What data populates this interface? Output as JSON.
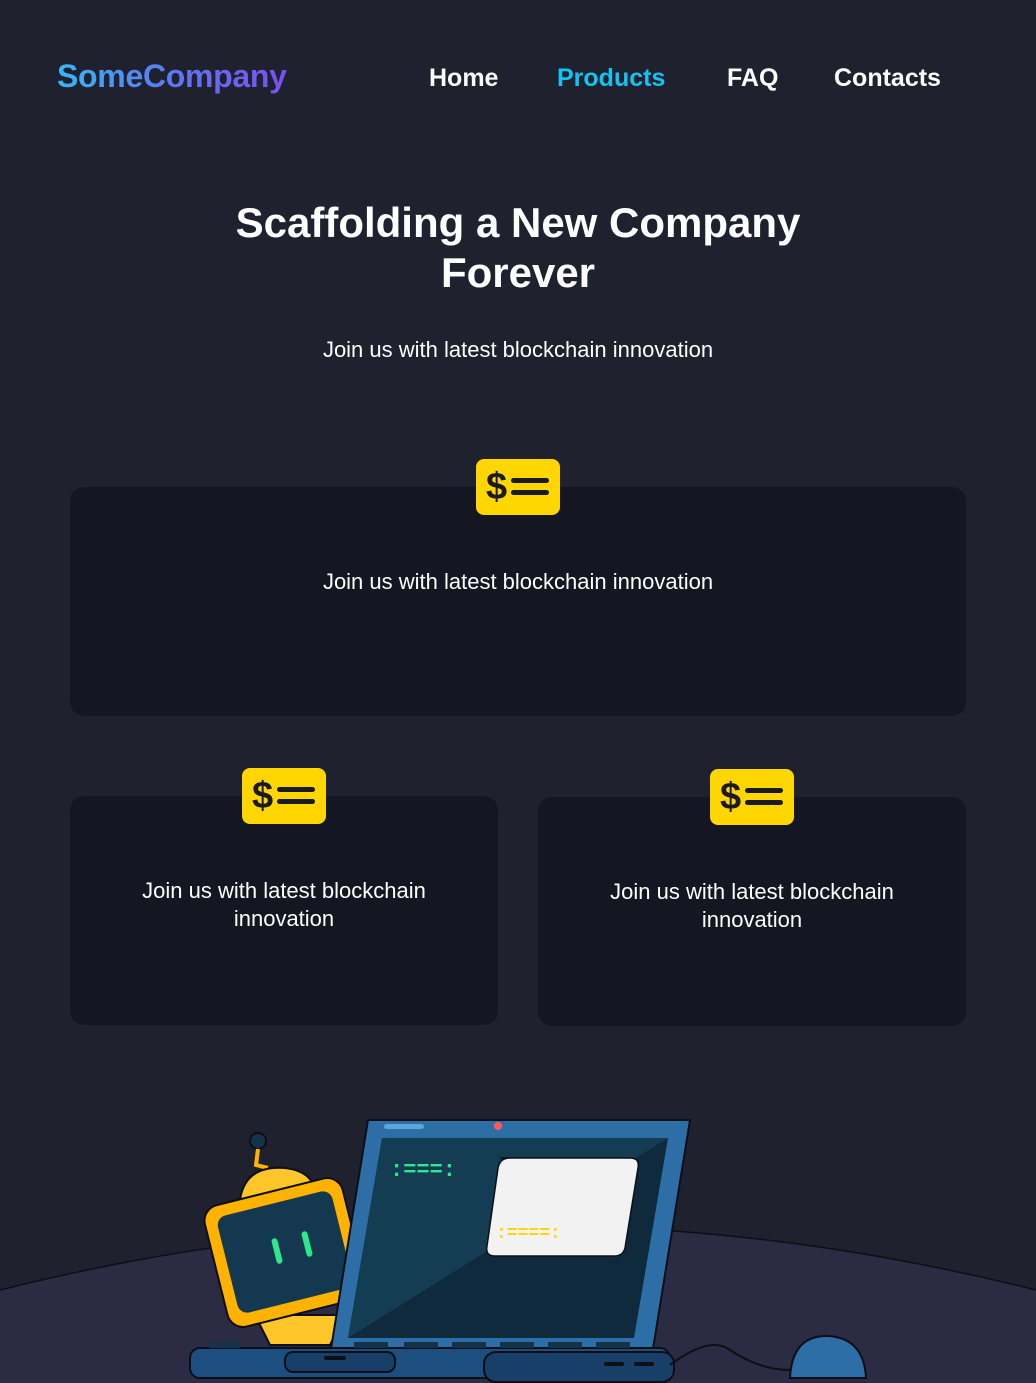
{
  "brand": {
    "prefix": "Some",
    "suffix": "Company"
  },
  "nav": {
    "items": [
      {
        "label": "Home",
        "active": false
      },
      {
        "label": "Products",
        "active": true
      },
      {
        "label": "FAQ",
        "active": false
      },
      {
        "label": "Contacts",
        "active": false
      }
    ]
  },
  "hero": {
    "title_line1": "Scaffolding a New Company",
    "title_line2": "Forever",
    "subtitle": "Join us with latest blockchain innovation"
  },
  "features": [
    {
      "icon": "dollar-list-icon",
      "text": "Join us with latest blockchain innovation"
    },
    {
      "icon": "dollar-list-icon",
      "text_line1": "Join us with latest blockchain",
      "text_line2": "innovation"
    },
    {
      "icon": "dollar-list-icon",
      "text_line1": "Join us with latest blockchain",
      "text_line2": "innovation"
    }
  ],
  "illustration": {
    "name": "robot-laptop-illustration"
  },
  "colors": {
    "background": "#1f212e",
    "card": "#141622",
    "accent": "#15c3f0",
    "badge": "#ffd600",
    "logo_gradient_start": "#38b6f5",
    "logo_gradient_end": "#7b4ff0"
  }
}
